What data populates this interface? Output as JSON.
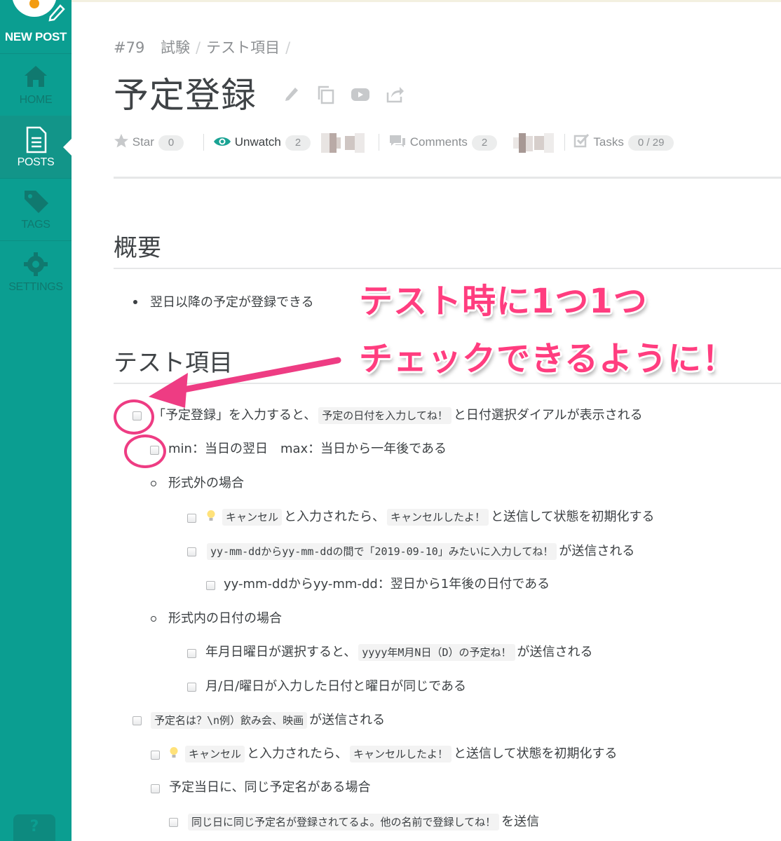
{
  "sidebar": {
    "new_post": "NEW POST",
    "items": [
      {
        "label": "HOME",
        "icon": "home-icon"
      },
      {
        "label": "POSTS",
        "icon": "document-icon"
      },
      {
        "label": "TAGS",
        "icon": "tag-icon"
      },
      {
        "label": "SETTINGS",
        "icon": "gear-icon"
      }
    ],
    "help": "?"
  },
  "post": {
    "number": "#79",
    "breadcrumb": [
      "試験",
      "テスト項目"
    ],
    "title": "予定登録",
    "star_label": "Star",
    "star_count": "0",
    "watch_label": "Unwatch",
    "watch_count": "2",
    "comments_label": "Comments",
    "comments_count": "2",
    "tasks_label": "Tasks",
    "tasks_count": "0 / 29"
  },
  "sections": {
    "overview_heading": "概要",
    "overview_bullet": "翌日以降の予定が登録できる",
    "test_heading": "テスト項目"
  },
  "tasks": {
    "t1_a": "「予定登録」を入力すると、",
    "t1_code": "予定の日付を入力してね！",
    "t1_b": "と日付選択ダイアルが表示される",
    "t2": "min：当日の翌日　max：当日から一年後である",
    "sub1": "形式外の場合",
    "t3_code1": "キャンセル",
    "t3_a": "と入力されたら、",
    "t3_code2": "キャンセルしたよ！",
    "t3_b": "と送信して状態を初期化する",
    "t4_code": "yy-mm-ddからyy-mm-ddの間で「2019-09-10」みたいに入力してね！",
    "t4_b": "が送信される",
    "t5": "yy-mm-ddからyy-mm-dd：翌日から1年後の日付である",
    "sub2": "形式内の日付の場合",
    "t6_a": "年月日曜日が選択すると、",
    "t6_code": "yyyy年M月N日（D）の予定ね！",
    "t6_b": "が送信される",
    "t7": "月/日/曜日が入力した日付と曜日が同じである",
    "t8_code": "予定名は？\\n例）飲み会、映画",
    "t8_b": "が送信される",
    "t9_code1": "キャンセル",
    "t9_a": "と入力されたら、",
    "t9_code2": "キャンセルしたよ！",
    "t9_b": "と送信して状態を初期化する",
    "t10": "予定当日に、同じ予定名がある場合",
    "t11_code": "同じ日に同じ予定名が登録されてるよ。他の名前で登録してね！",
    "t11_b": "を送信"
  },
  "annotation": {
    "line1": "テスト時に1つ1つ",
    "line2": "チェックできるように！",
    "color": "#ff3d7f"
  },
  "colors": {
    "sidebar": "#0b9e91",
    "accent": "#ee3c83"
  }
}
